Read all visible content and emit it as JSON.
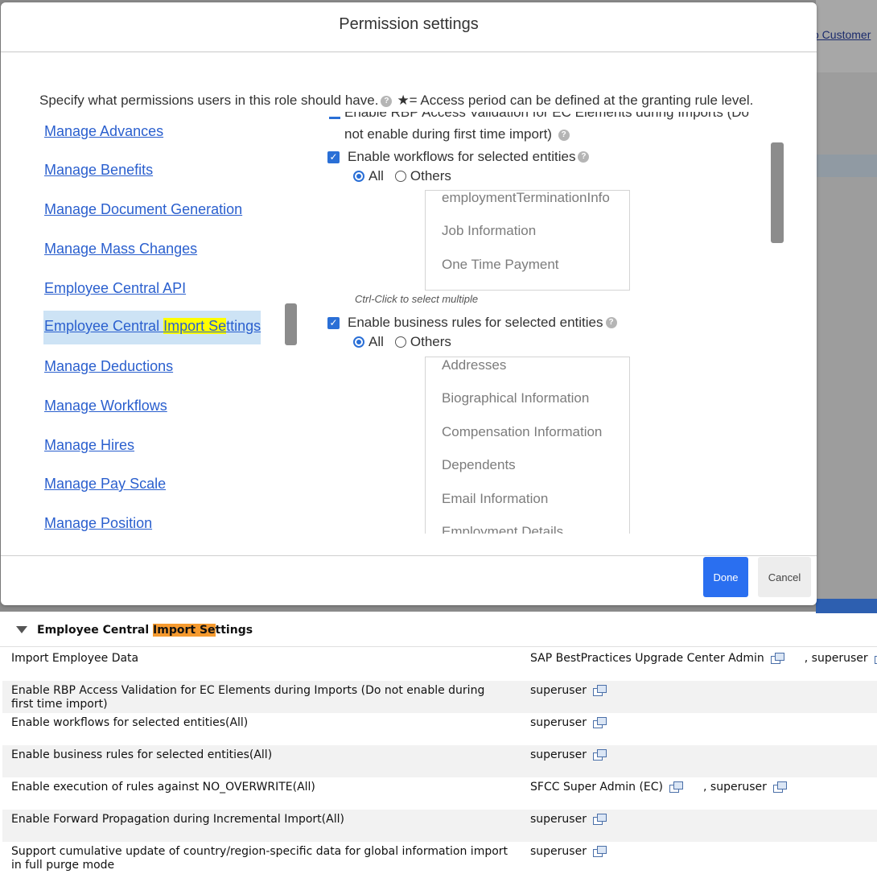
{
  "background": {
    "link_text": "o Customer"
  },
  "modal": {
    "title": "Permission settings",
    "intro": "Specify what permissions users in this role should have.",
    "star_note": "★= Access period can be defined at the granting rule level."
  },
  "nav": {
    "items": [
      {
        "label": "Manage Advances"
      },
      {
        "label": "Manage Benefits"
      },
      {
        "label": "Manage Document Generation"
      },
      {
        "label": "Manage Mass Changes"
      },
      {
        "label": "Employee Central API"
      },
      {
        "label_before": "Employee Central ",
        "label_hl": "Import Se",
        "label_after": "ttings"
      },
      {
        "label": "Manage Deductions"
      },
      {
        "label": "Manage Workflows"
      },
      {
        "label": "Manage Hires"
      },
      {
        "label": "Manage Pay Scale"
      },
      {
        "label": "Manage Position"
      }
    ]
  },
  "pane": {
    "cut_line1": "Enable RBP Access Validation for EC Elements during Imports (Do",
    "cut_line2": "not enable during first time import)",
    "workflows": {
      "label": "Enable workflows for selected entities",
      "radio_all": "All",
      "radio_others": "Others",
      "options": [
        "employmentTerminationInfo",
        "Job Information",
        "One Time Payment"
      ]
    },
    "hint": "Ctrl-Click to select multiple",
    "rules": {
      "label": "Enable business rules for selected entities",
      "radio_all": "All",
      "radio_others": "Others",
      "options": [
        "Addresses",
        "Biographical Information",
        "Compensation Information",
        "Dependents",
        "Email Information",
        "Employment Details"
      ]
    }
  },
  "footer": {
    "done": "Done",
    "cancel": "Cancel"
  },
  "summary": {
    "title_before": "Employee Central ",
    "title_hl": "Import Se",
    "title_after": "ttings",
    "rows": [
      {
        "permission": "Import Employee Data",
        "grantee1": "SAP BestPractices Upgrade Center Admin",
        "grantee2": ", superuser"
      },
      {
        "permission": "Enable RBP Access Validation for EC Elements during Imports (Do not enable during first time import)",
        "grantee1": "superuser"
      },
      {
        "permission": "Enable workflows for selected entities(All)",
        "grantee1": "superuser"
      },
      {
        "permission": "Enable business rules for selected entities(All)",
        "grantee1": "superuser"
      },
      {
        "permission": "Enable execution of rules against NO_OVERWRITE(All)",
        "grantee1": "SFCC Super Admin (EC)",
        "grantee2": ", superuser"
      },
      {
        "permission": "Enable Forward Propagation during Incremental Import(All)",
        "grantee1": "superuser"
      },
      {
        "permission": "Support cumulative update of country/region-specific data for global information import in full purge mode",
        "grantee1": "superuser"
      }
    ]
  }
}
